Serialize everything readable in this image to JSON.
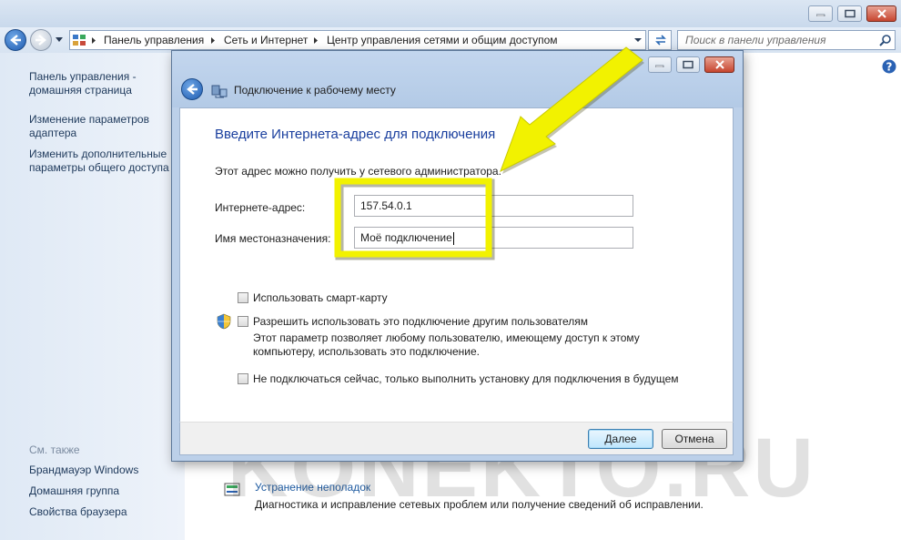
{
  "window": {
    "address": {
      "crumbs": [
        "Панель управления",
        "Сеть и Интернет",
        "Центр управления сетями и общим доступом"
      ],
      "search_placeholder": "Поиск в панели управления"
    },
    "sidebar": {
      "links": [
        "Панель управления - домашняя страница",
        "Изменение параметров адаптера",
        "Изменить дополнительные параметры общего доступа"
      ],
      "see_also_title": "См. также",
      "see_also": [
        "Брандмауэр Windows",
        "Домашняя группа",
        "Свойства браузера"
      ]
    },
    "troubleshoot": {
      "link": "Устранение неполадок",
      "description": "Диагностика и исправление сетевых проблем или получение сведений об исправлении."
    }
  },
  "dialog": {
    "title": "Подключение к рабочему месту",
    "heading": "Введите Интернета-адрес для подключения",
    "hint": "Этот адрес можно получить у сетевого администратора.",
    "address_label": "Интернете-адрес:",
    "address_value": "157.54.0.1",
    "name_label": "Имя местоназначения:",
    "name_value": "Моё подключение",
    "smartcard_label": "Использовать смарт-карту",
    "share_label": "Разрешить использовать это подключение другим пользователям",
    "share_description": "Этот параметр позволяет любому пользователю, имеющему доступ к этому компьютеру, использовать это подключение.",
    "later_label": "Не подключаться сейчас, только выполнить установку для подключения в будущем",
    "next_button": "Далее",
    "cancel_button": "Отмена"
  },
  "annotation": {
    "arrow_color": "#f2f200",
    "highlight_color": "#f2f200"
  },
  "watermark": "KONEKTO.RU"
}
